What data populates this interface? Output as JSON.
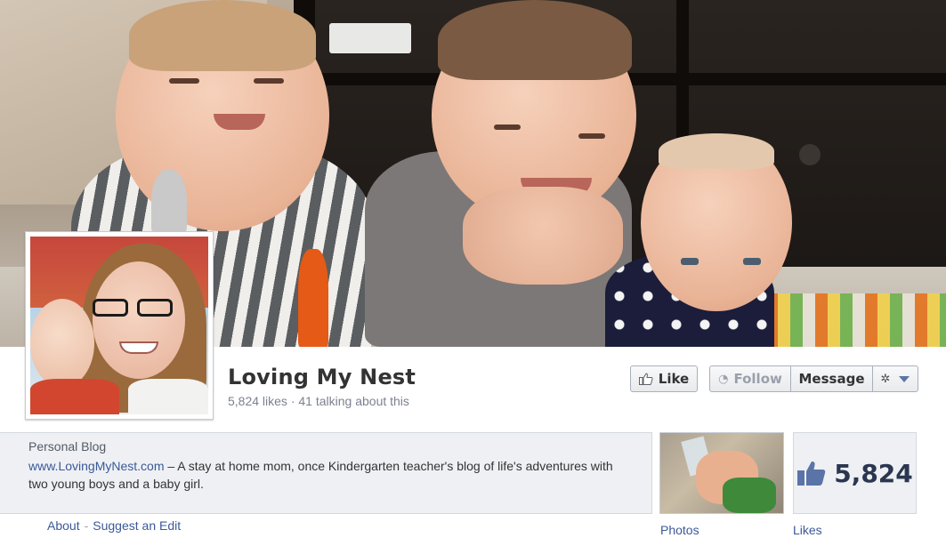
{
  "page": {
    "name": "Loving My Nest",
    "likes_text": "5,824 likes",
    "separator": "·",
    "talking_text": "41 talking about this"
  },
  "actions": {
    "like_label": "Like",
    "follow_label": "Follow",
    "message_label": "Message"
  },
  "info": {
    "category": "Personal Blog",
    "website": "www.LovingMyNest.com",
    "description": "– A stay at home mom, once Kindergarten teacher's blog of life's adventures with two young boys and a baby girl."
  },
  "links": {
    "about": "About",
    "separator": "-",
    "suggest_edit": "Suggest an Edit"
  },
  "tiles": {
    "photos_label": "Photos",
    "likes_label": "Likes",
    "likes_count": "5,824"
  },
  "colors": {
    "link": "#3b5998",
    "likes_count": "#2b3650",
    "info_bg": "#eef0f4"
  },
  "icons": [
    "thumbs-up-icon",
    "rss-icon",
    "gear-icon",
    "caret-down-icon"
  ]
}
